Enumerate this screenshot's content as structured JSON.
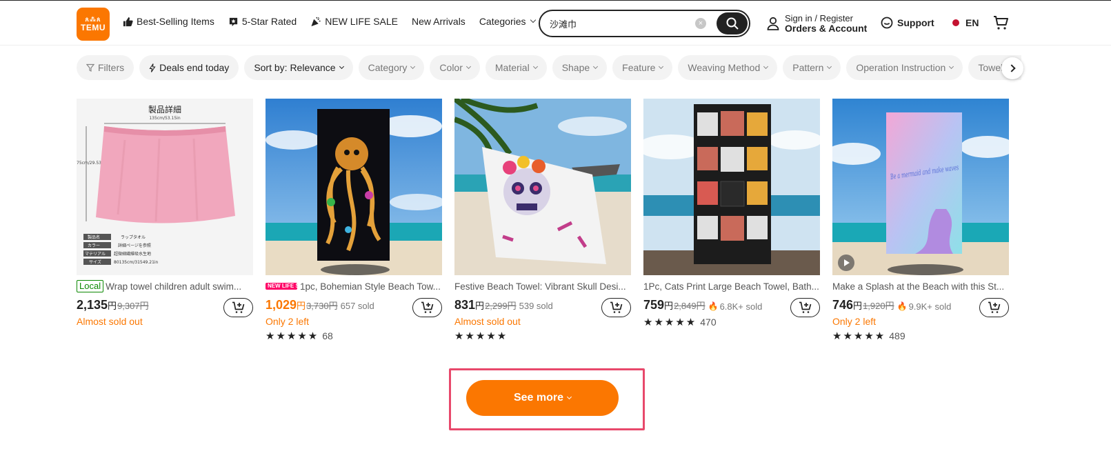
{
  "colors": {
    "brand": "#fb7701",
    "highlight": "#e8486b",
    "local_green": "#0a8800"
  },
  "header": {
    "logo_mark": "ጰ⁂ጰ",
    "logo_text": "TEMU",
    "nav": [
      {
        "label": "Best-Selling Items",
        "icon": "thumbs-up-icon"
      },
      {
        "label": "5-Star Rated",
        "icon": "star-badge-icon"
      },
      {
        "label": "NEW LIFE SALE",
        "icon": "confetti-icon"
      },
      {
        "label": "New Arrivals",
        "icon": ""
      },
      {
        "label": "Categories",
        "icon": "chevron-down-icon"
      }
    ],
    "search": {
      "value": "沙滩巾",
      "clear": "×"
    },
    "account": {
      "small": "Sign in / Register",
      "big": "Orders & Account"
    },
    "support": "Support",
    "language": "EN"
  },
  "filters": [
    {
      "label": "Filters",
      "dark": false
    },
    {
      "label": "Deals end today",
      "dark": true
    },
    {
      "label": "Sort by: Relevance",
      "dark": true
    },
    {
      "label": "Category",
      "dark": false
    },
    {
      "label": "Color",
      "dark": false
    },
    {
      "label": "Material",
      "dark": false
    },
    {
      "label": "Shape",
      "dark": false
    },
    {
      "label": "Feature",
      "dark": false
    },
    {
      "label": "Weaving Method",
      "dark": false
    },
    {
      "label": "Pattern",
      "dark": false
    },
    {
      "label": "Operation Instruction",
      "dark": false
    },
    {
      "label": "Towel Theme",
      "dark": false
    }
  ],
  "products": [
    {
      "badge": "Local",
      "title": "Wrap towel children adult swim...",
      "price": "2,135",
      "currency": "円",
      "old_price": "9,307円",
      "sold": "",
      "hot": false,
      "urgency": "Almost sold out",
      "stars": "",
      "reviews": "",
      "price_orange": false,
      "image_text": {
        "heading": "製品詳細",
        "width": "135cm/53.15in",
        "height": "75cm/29.53in",
        "spec_labels": [
          "製品名",
          "カラー",
          "マテリアル",
          "サイズ"
        ],
        "spec_values": [
          "ラップタオル",
          "詳細ページを参照",
          "超微細繊維吸水生地",
          "80135cm/31549.21in"
        ]
      }
    },
    {
      "badge": "NEW LIFE SALE",
      "title": "1pc, Bohemian Style Beach Tow...",
      "price": "1,029",
      "currency": "円",
      "old_price": "3,730円",
      "sold": "657 sold",
      "hot": false,
      "urgency": "Only 2 left",
      "stars": "★★★★★",
      "reviews": "68",
      "price_orange": true
    },
    {
      "badge": "",
      "title": "Festive Beach Towel: Vibrant Skull Desi...",
      "price": "831",
      "currency": "円",
      "old_price": "2,299円",
      "sold": "539 sold",
      "hot": false,
      "urgency": "Almost sold out",
      "stars": "★★★★★",
      "reviews": "",
      "price_orange": false
    },
    {
      "badge": "",
      "title": "1Pc, Cats Print Large Beach Towel, Bath...",
      "price": "759",
      "currency": "円",
      "old_price": "2,849円",
      "sold": "6.8K+ sold",
      "hot": true,
      "urgency": "",
      "stars": "★★★★★",
      "reviews": "470",
      "price_orange": false
    },
    {
      "badge": "",
      "title": "Make a Splash at the Beach with this St...",
      "price": "746",
      "currency": "円",
      "old_price": "1,920円",
      "sold": "9.9K+ sold",
      "hot": true,
      "urgency": "Only 2 left",
      "stars": "★★★★★",
      "reviews": "489",
      "price_orange": false,
      "image_text": {
        "towel_lettering": "Be a mermaid and make waves"
      }
    }
  ],
  "see_more": "See more"
}
